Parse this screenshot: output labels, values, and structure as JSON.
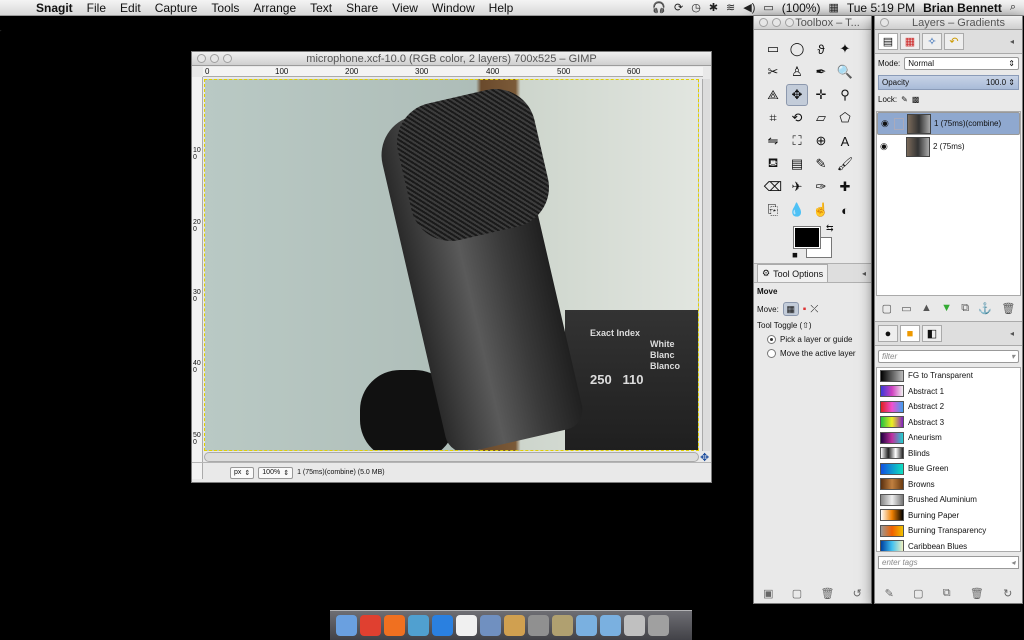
{
  "menubar": {
    "app": "Snagit",
    "items": [
      "File",
      "Edit",
      "Capture",
      "Tools",
      "Arrange",
      "Text",
      "Share",
      "View",
      "Window",
      "Help"
    ],
    "battery": "(100%)",
    "clock": "Tue 5:19 PM",
    "user": "Brian Bennett"
  },
  "image_window": {
    "title": "microphone.xcf-10.0 (RGB color, 2 layers) 700x525 – GIMP",
    "ruler_h": [
      "0",
      "100",
      "200",
      "300",
      "400",
      "500",
      "600"
    ],
    "ruler_v": [
      "100",
      "200",
      "300",
      "400",
      "500"
    ],
    "box_text": [
      "Exact Index",
      "White",
      "Blanc",
      "Blanco",
      "250",
      "110"
    ],
    "status": {
      "unit": "px",
      "zoom": "100%",
      "info": "1 (75ms)(combine) (5.0 MB)"
    }
  },
  "toolbox": {
    "title": "Toolbox – T...",
    "tools": [
      {
        "name": "rect-select-icon",
        "glyph": "▭"
      },
      {
        "name": "ellipse-select-icon",
        "glyph": "◯"
      },
      {
        "name": "free-select-icon",
        "glyph": "ϑ"
      },
      {
        "name": "fuzzy-select-icon",
        "glyph": "✦"
      },
      {
        "name": "scissors-icon",
        "glyph": "✂"
      },
      {
        "name": "foreground-select-icon",
        "glyph": "♙"
      },
      {
        "name": "paths-icon",
        "glyph": "✒"
      },
      {
        "name": "zoom-icon",
        "glyph": "🔍"
      },
      {
        "name": "measure-icon",
        "glyph": "⟁"
      },
      {
        "name": "move-icon",
        "glyph": "✥"
      },
      {
        "name": "align-icon",
        "glyph": "✛"
      },
      {
        "name": "color-picker-icon",
        "glyph": "⚲"
      },
      {
        "name": "crop-icon",
        "glyph": "⌗"
      },
      {
        "name": "rotate-icon",
        "glyph": "⟲"
      },
      {
        "name": "shear-icon",
        "glyph": "▱"
      },
      {
        "name": "perspective-icon",
        "glyph": "⬠"
      },
      {
        "name": "flip-icon",
        "glyph": "⇋"
      },
      {
        "name": "cage-icon",
        "glyph": "⛶"
      },
      {
        "name": "unified-transform-icon",
        "glyph": "⊕"
      },
      {
        "name": "text-icon",
        "glyph": "A"
      },
      {
        "name": "bucket-fill-icon",
        "glyph": "⛾"
      },
      {
        "name": "blend-icon",
        "glyph": "▤"
      },
      {
        "name": "pencil-icon",
        "glyph": "✎"
      },
      {
        "name": "paintbrush-icon",
        "glyph": "🖌"
      },
      {
        "name": "eraser-icon",
        "glyph": "⌫"
      },
      {
        "name": "airbrush-icon",
        "glyph": "✈"
      },
      {
        "name": "ink-icon",
        "glyph": "✑"
      },
      {
        "name": "heal-icon",
        "glyph": "✚"
      },
      {
        "name": "clone-icon",
        "glyph": "⎘"
      },
      {
        "name": "blur-icon",
        "glyph": "💧"
      },
      {
        "name": "smudge-icon",
        "glyph": "☝"
      },
      {
        "name": "dodge-icon",
        "glyph": "◐"
      }
    ],
    "tab_label": "Tool Options",
    "options": {
      "heading": "Move",
      "move_label": "Move:",
      "toggle_label": "Tool Toggle  (⇧)",
      "radio1": "Pick a layer or guide",
      "radio2": "Move the active layer"
    }
  },
  "layers": {
    "title": "Layers – Gradients",
    "mode_label": "Mode:",
    "mode_value": "Normal",
    "opacity_label": "Opacity",
    "opacity_value": "100.0",
    "lock_label": "Lock:",
    "items": [
      {
        "name": "1 (75ms)(combine)",
        "selected": true
      },
      {
        "name": "2 (75ms)",
        "selected": false
      }
    ],
    "filter_placeholder": "filter",
    "gradients": [
      {
        "name": "FG to Transparent",
        "colors": "#000,#bbb"
      },
      {
        "name": "Abstract 1",
        "colors": "#3a3ad8,#d040c0,#f0f0f0"
      },
      {
        "name": "Abstract 2",
        "colors": "#e02020,#f050d0,#40a0f0"
      },
      {
        "name": "Abstract 3",
        "colors": "#20c040,#f0f020,#8020c0"
      },
      {
        "name": "Aneurism",
        "colors": "#200040,#c030a0,#20d0d0"
      },
      {
        "name": "Blinds",
        "colors": "#fff,#222,#fff,#222"
      },
      {
        "name": "Blue Green",
        "colors": "#1050e0,#10e0c0"
      },
      {
        "name": "Browns",
        "colors": "#5a3010,#c08040,#6a3a10"
      },
      {
        "name": "Brushed Aluminium",
        "colors": "#888,#eee,#777"
      },
      {
        "name": "Burning Paper",
        "colors": "#fff,#f08000,#000"
      },
      {
        "name": "Burning Transparency",
        "colors": "#999,#f06000,#f0c000"
      },
      {
        "name": "Caribbean Blues",
        "colors": "#0040a0,#40c0f0,#f0f0c0"
      }
    ],
    "tags_placeholder": "enter tags"
  },
  "dock": [
    "finder",
    "chrome",
    "firefox",
    "preview",
    "appstore",
    "calendar",
    "textedit",
    "photo",
    "gear",
    "gimp",
    "folder",
    "folder2",
    "docs",
    "trash"
  ]
}
